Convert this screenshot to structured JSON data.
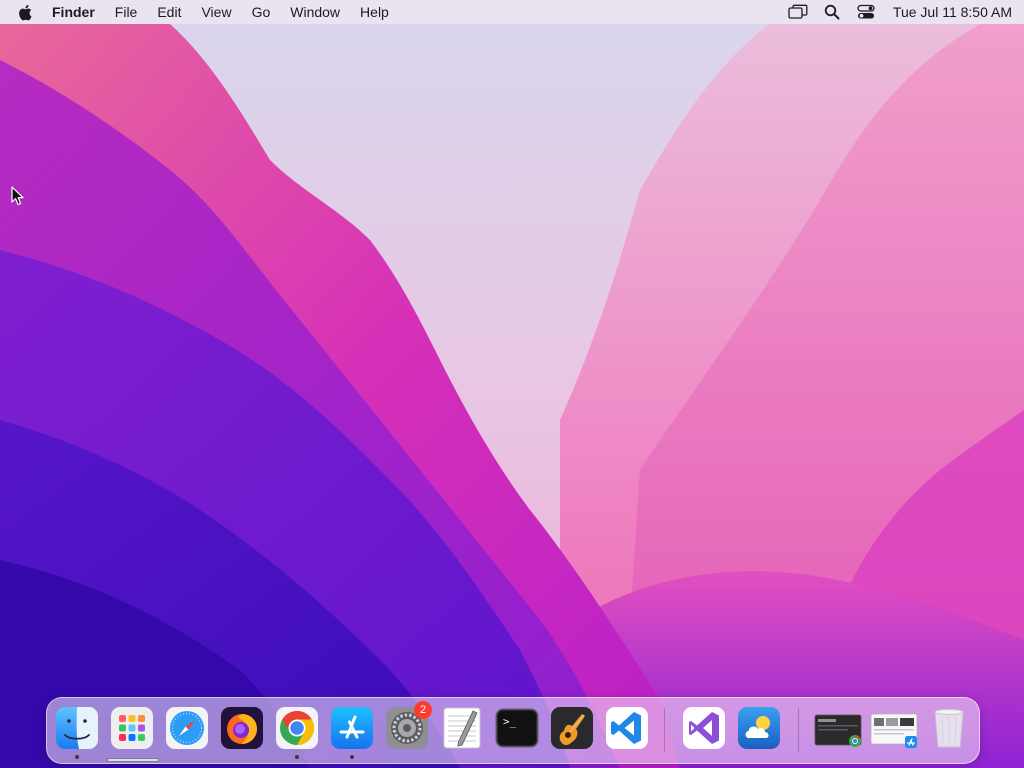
{
  "menubar": {
    "app_name": "Finder",
    "menus": [
      "File",
      "Edit",
      "View",
      "Go",
      "Window",
      "Help"
    ],
    "status_icons": [
      "screen-mirroring-icon",
      "spotlight-search-icon",
      "control-center-icon"
    ],
    "clock": "Tue Jul 11  8:50 AM"
  },
  "dock": {
    "items": [
      {
        "name": "Finder",
        "icon": "finder-icon",
        "running": true
      },
      {
        "name": "Launchpad",
        "icon": "launchpad-icon",
        "running": false
      },
      {
        "name": "Safari",
        "icon": "safari-icon",
        "running": false
      },
      {
        "name": "Firefox",
        "icon": "firefox-icon",
        "running": false
      },
      {
        "name": "Google Chrome",
        "icon": "chrome-icon",
        "running": true
      },
      {
        "name": "App Store",
        "icon": "app-store-icon",
        "running": true
      },
      {
        "name": "System Preferences",
        "icon": "system-preferences-icon",
        "running": false,
        "badge": "2"
      },
      {
        "name": "TextEdit",
        "icon": "textedit-icon",
        "running": false
      },
      {
        "name": "Terminal",
        "icon": "terminal-icon",
        "running": false
      },
      {
        "name": "GarageBand",
        "icon": "garageband-icon",
        "running": false
      },
      {
        "name": "Visual Studio Code",
        "icon": "vscode-icon",
        "running": false
      },
      {
        "name": "Visual Studio",
        "icon": "visual-studio-icon",
        "running": false
      },
      {
        "name": "Weather",
        "icon": "weather-icon",
        "running": false
      },
      {
        "name": "Recent Window 1",
        "icon": "window-thumbnail-icon",
        "running": false
      },
      {
        "name": "Recent Window 2",
        "icon": "window-thumbnail-icon",
        "running": false
      },
      {
        "name": "Trash",
        "icon": "trash-icon",
        "running": false
      }
    ]
  },
  "colors": {
    "accent": "#e03ec8",
    "wallpaper_deep": "#3d0fc4",
    "wallpaper_light": "#f1d8ee"
  }
}
